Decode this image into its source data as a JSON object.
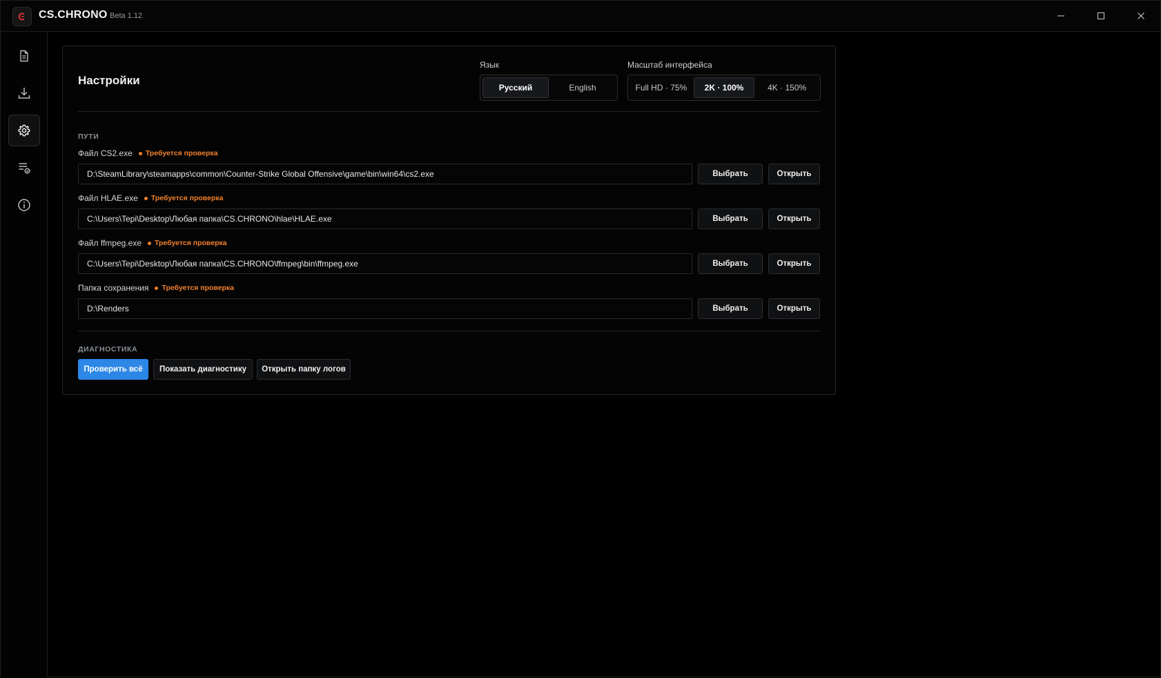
{
  "titlebar": {
    "app_name": "CS.CHRONO",
    "version": "Beta 1.12",
    "logo_icon": "cschrono-logo-icon",
    "controls": [
      "minimize-icon",
      "maximize-icon",
      "close-icon"
    ]
  },
  "sidebar": {
    "items": [
      {
        "icon": "document-icon",
        "active": false
      },
      {
        "icon": "download-icon",
        "active": false
      },
      {
        "icon": "gear-icon",
        "active": true
      },
      {
        "icon": "queue-list-icon",
        "active": false
      },
      {
        "icon": "info-icon",
        "active": false
      }
    ]
  },
  "settings": {
    "title": "Настройки",
    "language": {
      "label": "Язык",
      "options": [
        "Русский",
        "English"
      ],
      "selected": "Русский"
    },
    "scale": {
      "label": "Масштаб интерфейса",
      "options": [
        "Full HD · 75%",
        "2K · 100%",
        "4K · 150%"
      ],
      "selected": "2K · 100%"
    },
    "paths": {
      "section_label": "ПУТИ",
      "choose_label": "Выбрать",
      "open_label": "Открыть",
      "items": [
        {
          "label": "Файл CS2.exe",
          "warning": "Требуется проверка",
          "value": "D:\\SteamLibrary\\steamapps\\common\\Counter-Strike Global Offensive\\game\\bin\\win64\\cs2.exe"
        },
        {
          "label": "Файл HLAE.exe",
          "warning": "Требуется проверка",
          "value": "C:\\Users\\Tepi\\Desktop\\Любая папка\\CS.CHRONO\\hlae\\HLAE.exe"
        },
        {
          "label": "Файл ffmpeg.exe",
          "warning": "Требуется проверка",
          "value": "C:\\Users\\Tepi\\Desktop\\Любая папка\\CS.CHRONO\\ffmpeg\\bin\\ffmpeg.exe"
        },
        {
          "label": "Папка сохранения",
          "warning": "Требуется проверка",
          "value": "D:\\Renders"
        }
      ]
    },
    "diagnostics": {
      "section_label": "ДИАГНОСТИКА",
      "check_all": "Проверить всё",
      "show_diagnostics": "Показать диагностику",
      "open_logs": "Открыть папку логов"
    }
  },
  "colors": {
    "accent": "#2c87e6",
    "warning": "#f0812d",
    "background": "#000000"
  }
}
